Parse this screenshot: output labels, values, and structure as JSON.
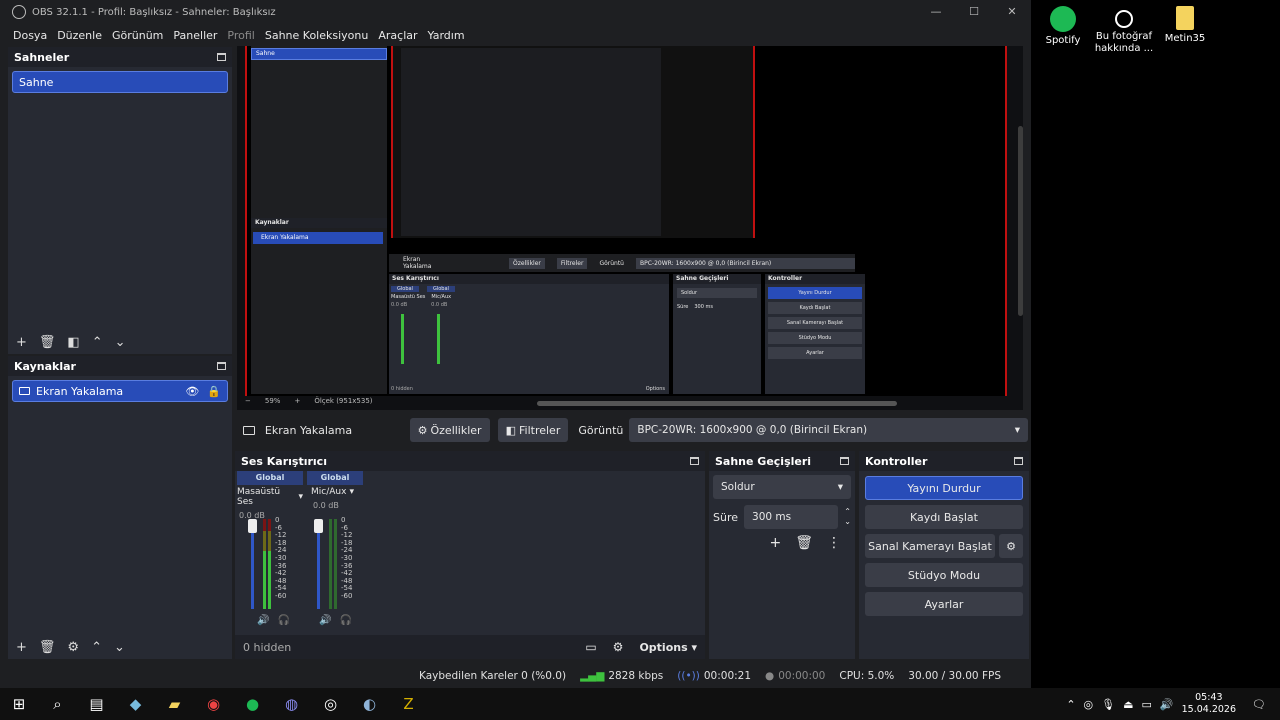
{
  "window": {
    "title": "OBS 32.1.1 - Profil: Başlıksız - Sahneler: Başlıksız",
    "controls": [
      "—",
      "☐",
      "✕"
    ]
  },
  "menu": [
    "Dosya",
    "Düzenle",
    "Görünüm",
    "Paneller",
    "Profil",
    "Sahne Koleksiyonu",
    "Araçlar",
    "Yardım"
  ],
  "scenes": {
    "title": "Sahneler",
    "items": [
      "Sahne"
    ]
  },
  "sources": {
    "title": "Kaynaklar",
    "items": [
      "Ekran Yakalama"
    ]
  },
  "source_toolbar": {
    "name": "Ekran Yakalama",
    "properties": "Özellikler",
    "filters": "Filtreler",
    "display_label": "Görüntü",
    "display_value": "BPC-20WR: 1600x900 @ 0,0 (Birincil Ekran)"
  },
  "mixer": {
    "title": "Ses Karıştırıcı",
    "channels": [
      {
        "head": "Global",
        "name": "Masaüstü Ses",
        "db": "0.0 dB"
      },
      {
        "head": "Global",
        "name": "Mic/Aux",
        "db": "0.0 dB"
      }
    ],
    "scale": [
      "0",
      "-6",
      "-12",
      "-18",
      "-24",
      "-30",
      "-36",
      "-42",
      "-48",
      "-54",
      "-60"
    ],
    "hidden": "0 hidden",
    "options": "Options"
  },
  "transitions": {
    "title": "Sahne Geçişleri",
    "type": "Soldur",
    "duration_label": "Süre",
    "duration_value": "300 ms"
  },
  "controls": {
    "title": "Kontroller",
    "stop_stream": "Yayını Durdur",
    "start_record": "Kaydı Başlat",
    "virtual_cam": "Sanal Kamerayı Başlat",
    "studio_mode": "Stüdyo Modu",
    "settings": "Ayarlar"
  },
  "statusbar": {
    "dropped": "Kaybedilen Kareler 0 (%0.0)",
    "bitrate": "2828 kbps",
    "stream_time": "00:00:21",
    "record_time": "00:00:00",
    "cpu": "CPU: 5.0%",
    "fps": "30.00 / 30.00 FPS"
  },
  "nested_preview": {
    "sources_title": "Kaynaklar",
    "source_item": "Ekran Yakalama",
    "scene_item": "Sahne",
    "display_value": "BPC-20WR: 1600x900 @ 0,0 (Birincil Ekran)",
    "properties": "Özellikler",
    "filters": "Filtreler",
    "display_label": "Görüntü",
    "mixer_title": "Ses Karıştırıcı",
    "transitions_title": "Sahne Geçişleri",
    "controls_title": "Kontroller",
    "stop_stream": "Yayını Durdur",
    "start_record": "Kaydı Başlat",
    "virtual_cam": "Sanal Kamerayı Başlat",
    "studio_mode": "Stüdyo Modu",
    "settings": "Ayarlar",
    "type": "Soldur",
    "duration_label": "Süre",
    "duration_value": "300 ms",
    "hidden": "0 hidden",
    "options": "Options",
    "zoom": "59%",
    "scale_info": "Ölçek (951x535)",
    "ch1": "Masaüstü Ses",
    "ch2": "Mic/Aux",
    "global": "Global",
    "db": "0.0 dB"
  },
  "desktop_icons": [
    {
      "label": "Spotify"
    },
    {
      "label": "Bu fotoğraf hakkında ..."
    },
    {
      "label": "Metin35"
    }
  ],
  "taskbar": {
    "time": "05:43",
    "date": "15.04.2026"
  }
}
